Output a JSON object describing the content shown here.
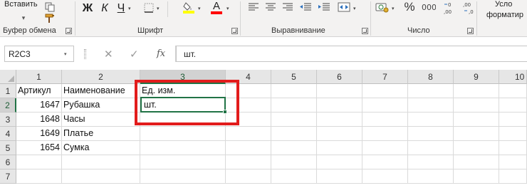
{
  "ribbon": {
    "clipboard": {
      "paste_label": "Вставить",
      "group_label": "Буфер обмена"
    },
    "font": {
      "bold": "Ж",
      "italic": "К",
      "underline": "Ч",
      "font_color_letter": "A",
      "group_label": "Шрифт"
    },
    "alignment": {
      "group_label": "Выравнивание"
    },
    "number": {
      "percent": "%",
      "group_label": "Число"
    },
    "styles": {
      "line1": "Усло",
      "line2": "форматир"
    },
    "colors": {
      "highlight": "#ffff00",
      "font_color": "#ff0000",
      "accent": "#217346"
    }
  },
  "formula_bar": {
    "name_box": "R2C3",
    "fx_label": "fx",
    "content": "шт."
  },
  "grid": {
    "columns": [
      "1",
      "2",
      "3",
      "4",
      "5",
      "6",
      "7",
      "8",
      "9",
      "10"
    ],
    "rows": [
      "1",
      "2",
      "3",
      "4",
      "5",
      "6",
      "7"
    ],
    "selected_column": "3",
    "selected_row": "2",
    "cells": {
      "r1": {
        "c1": "Артикул",
        "c2": "Наименование",
        "c3": "Ед. изм."
      },
      "r2": {
        "c1": "1647",
        "c2": "Рубашка",
        "c3": "шт."
      },
      "r3": {
        "c1": "1648",
        "c2": "Часы"
      },
      "r4": {
        "c1": "1649",
        "c2": "Платье"
      },
      "r5": {
        "c1": "1654",
        "c2": "Сумка"
      }
    },
    "annotation_color": "#e21c1c"
  }
}
